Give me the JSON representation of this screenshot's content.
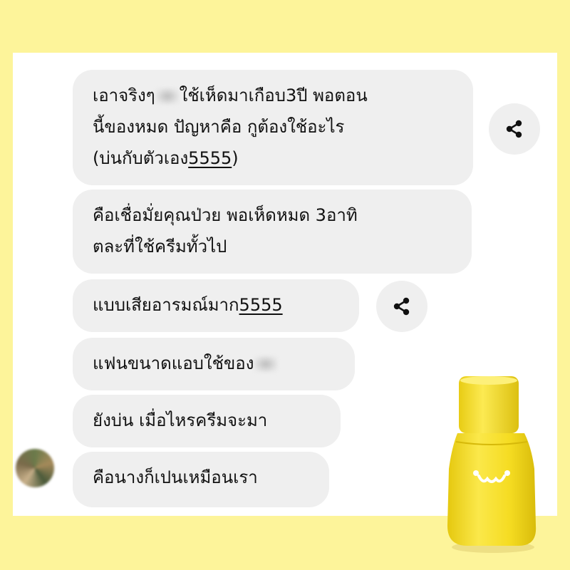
{
  "messages": [
    {
      "lines": [
        "เอาจริงๆ",
        "ใช้เห็ดมาเกือบ3ปี พอตอน",
        "นี้ของหมด ปัญหาคือ กูต้องใช้อะไร",
        "(บ่นกับตัวเอง",
        "5555",
        ")"
      ]
    },
    {
      "lines": [
        "คือเชื่อมั่ยคุณป่วย พอเห็ดหมด 3อาทิ",
        "ตละที่ใช้ครีมทั้วไป"
      ]
    },
    {
      "lines": [
        "แบบเสียอารมณ์มาก",
        "5555"
      ]
    },
    {
      "lines": [
        "แฟนขนาดแอบใช้ของ"
      ]
    },
    {
      "lines": [
        "ยังบ่น เมื่อไหรครีมจะมา"
      ]
    },
    {
      "lines": [
        "คือนางก็เปนเหมือนเรา"
      ]
    }
  ],
  "icons": {
    "share": "share-icon",
    "avatar": "avatar",
    "product": "yellow-bottle"
  },
  "colors": {
    "background": "#fdf49a",
    "bubble": "#efefef",
    "bottle": "#f7e12c"
  }
}
